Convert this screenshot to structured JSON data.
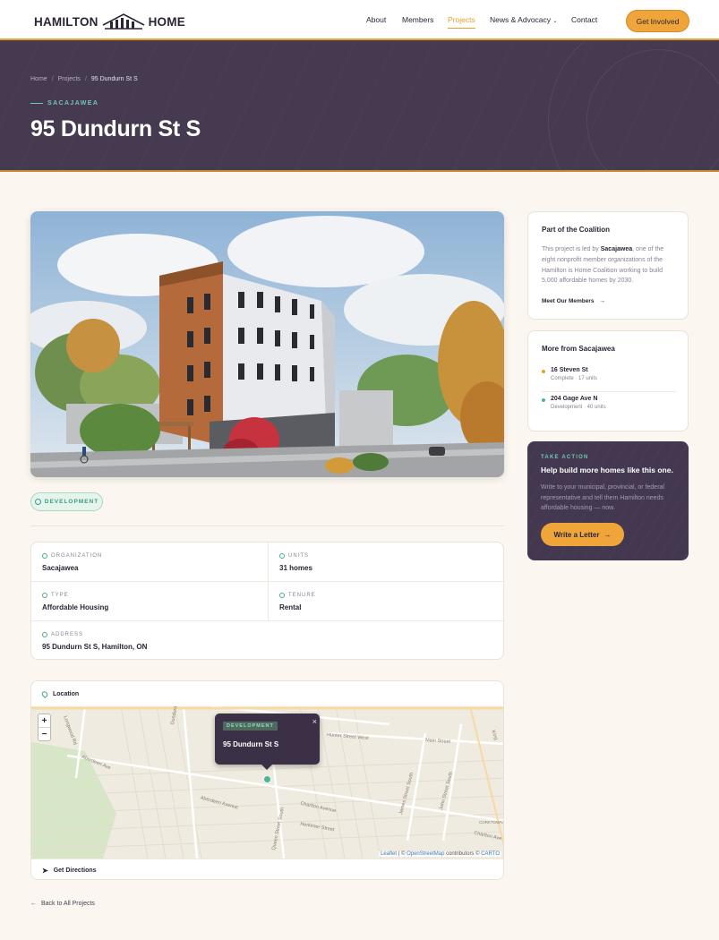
{
  "header": {
    "logo_left": "HAMILTON",
    "logo_right": "HOME",
    "nav": [
      "About",
      "Members",
      "Projects",
      "News & Advocacy",
      "Contact"
    ],
    "active_nav": "Projects",
    "cta": "Get Involved",
    "accent_color": "#e79f2d"
  },
  "hero": {
    "breadcrumb": [
      "Home",
      "Projects",
      "95 Dundurn St S"
    ],
    "eyebrow": "SACAJAWEA",
    "title": "95 Dundurn St S",
    "bg_color": "#453a50"
  },
  "project": {
    "status": "DEVELOPMENT",
    "details": [
      {
        "label": "ORGANIZATION",
        "value": "Sacajawea"
      },
      {
        "label": "UNITS",
        "value": "31 homes"
      },
      {
        "label": "TYPE",
        "value": "Affordable Housing"
      },
      {
        "label": "TENURE",
        "value": "Rental"
      },
      {
        "label": "ADDRESS",
        "value": "95 Dundurn St S, Hamilton, ON"
      }
    ]
  },
  "map": {
    "heading": "Location",
    "zoom_in": "+",
    "zoom_out": "−",
    "popup_tag": "DEVELOPMENT",
    "popup_title": "95 Dundurn St S",
    "popup_close": "×",
    "attribution_leaflet": "Leaflet",
    "attribution_mid": " | © ",
    "attribution_osm": "OpenStreetMap",
    "attribution_contrib": " contributors © ",
    "attribution_carto": "CARTO",
    "directions": "Get Directions",
    "street_labels": [
      "Longwood Rd",
      "Aberdeen Ave",
      "Dundurn Street South",
      "Hunter Street West",
      "Jackson Street West",
      "Main Street",
      "Charlton Avenue",
      "Herkimer Street",
      "James Street South",
      "John Street South",
      "Queen Street South",
      "Locke Street",
      "Aberdeen Avenue",
      "Charlton Ave",
      "CORKTOWN",
      "King"
    ]
  },
  "back_link": "Back to All Projects",
  "sidebar": {
    "coalition": {
      "title": "Part of the Coalition",
      "text_pre": "This project is led by ",
      "org": "Sacajawea",
      "text_post": ", one of the eight nonprofit member organizations of the Hamilton is Home Coalition working to build 5,000 affordable homes by 2030.",
      "link": "Meet Our Members"
    },
    "more": {
      "title": "More from Sacajawea",
      "items": [
        {
          "name": "16 Steven St",
          "meta": "Complete · 17 units",
          "color": "#e79f2d"
        },
        {
          "name": "204 Gage Ave N",
          "meta": "Development · 40 units",
          "color": "#4fb394"
        }
      ]
    },
    "action": {
      "eyebrow": "TAKE ACTION",
      "title": "Help build more homes like this one.",
      "text": "Write to your municipal, provincial, or federal representative and tell them Hamilton needs affordable housing — now.",
      "button": "Write a Letter"
    }
  }
}
